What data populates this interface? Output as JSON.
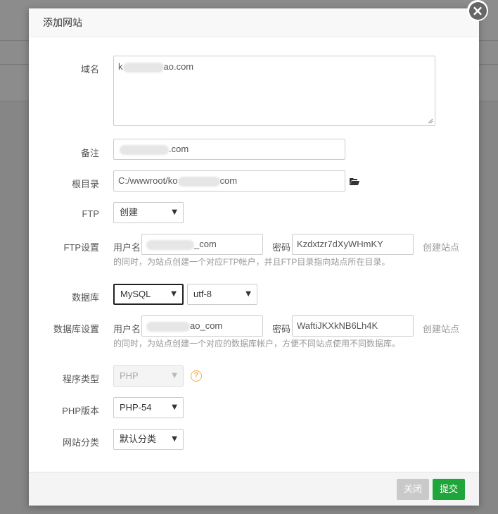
{
  "dialog": {
    "title": "添加网站",
    "close_icon": "×"
  },
  "form": {
    "domain": {
      "label": "域名",
      "value_prefix": "k",
      "value_suffix": "ao.com"
    },
    "remark": {
      "label": "备注",
      "value_suffix": ".com"
    },
    "root": {
      "label": "根目录",
      "value_prefix": "C:/wwwroot/ko",
      "value_suffix": "com"
    },
    "ftp": {
      "label": "FTP",
      "selected": "创建"
    },
    "ftp_settings": {
      "label": "FTP设置",
      "user_label": "用户名",
      "user_value_suffix": "_com",
      "pass_label": "密码",
      "pass_value": "Kzdxtzr7dXyWHmKY",
      "hint_tail": "创建站点",
      "hint": "的同时，为站点创建一个对应FTP帐户，并且FTP目录指向站点所在目录。"
    },
    "database": {
      "label": "数据库",
      "type_selected": "MySQL",
      "charset_selected": "utf-8"
    },
    "db_settings": {
      "label": "数据库设置",
      "user_label": "用户名",
      "user_value_suffix": "ao_com",
      "pass_label": "密码",
      "pass_value": "WaftiJKXkNB6Lh4K",
      "hint_tail": "创建站点",
      "hint": "的同时，为站点创建一个对应的数据库帐户，方便不同站点使用不同数据库。"
    },
    "program_type": {
      "label": "程序类型",
      "selected": "PHP",
      "help_icon": "?"
    },
    "php_version": {
      "label": "PHP版本",
      "selected": "PHP-54"
    },
    "category": {
      "label": "网站分类",
      "selected": "默认分类"
    }
  },
  "footer": {
    "close_label": "关闭",
    "submit_label": "提交"
  },
  "colors": {
    "submit": "#20a53a",
    "close": "#c9c9c9",
    "help": "#f0ad4e"
  },
  "icons": {
    "folder": "folder-open-icon",
    "close": "close-icon",
    "help": "question-circle-icon",
    "caret": "chevron-down-icon"
  }
}
